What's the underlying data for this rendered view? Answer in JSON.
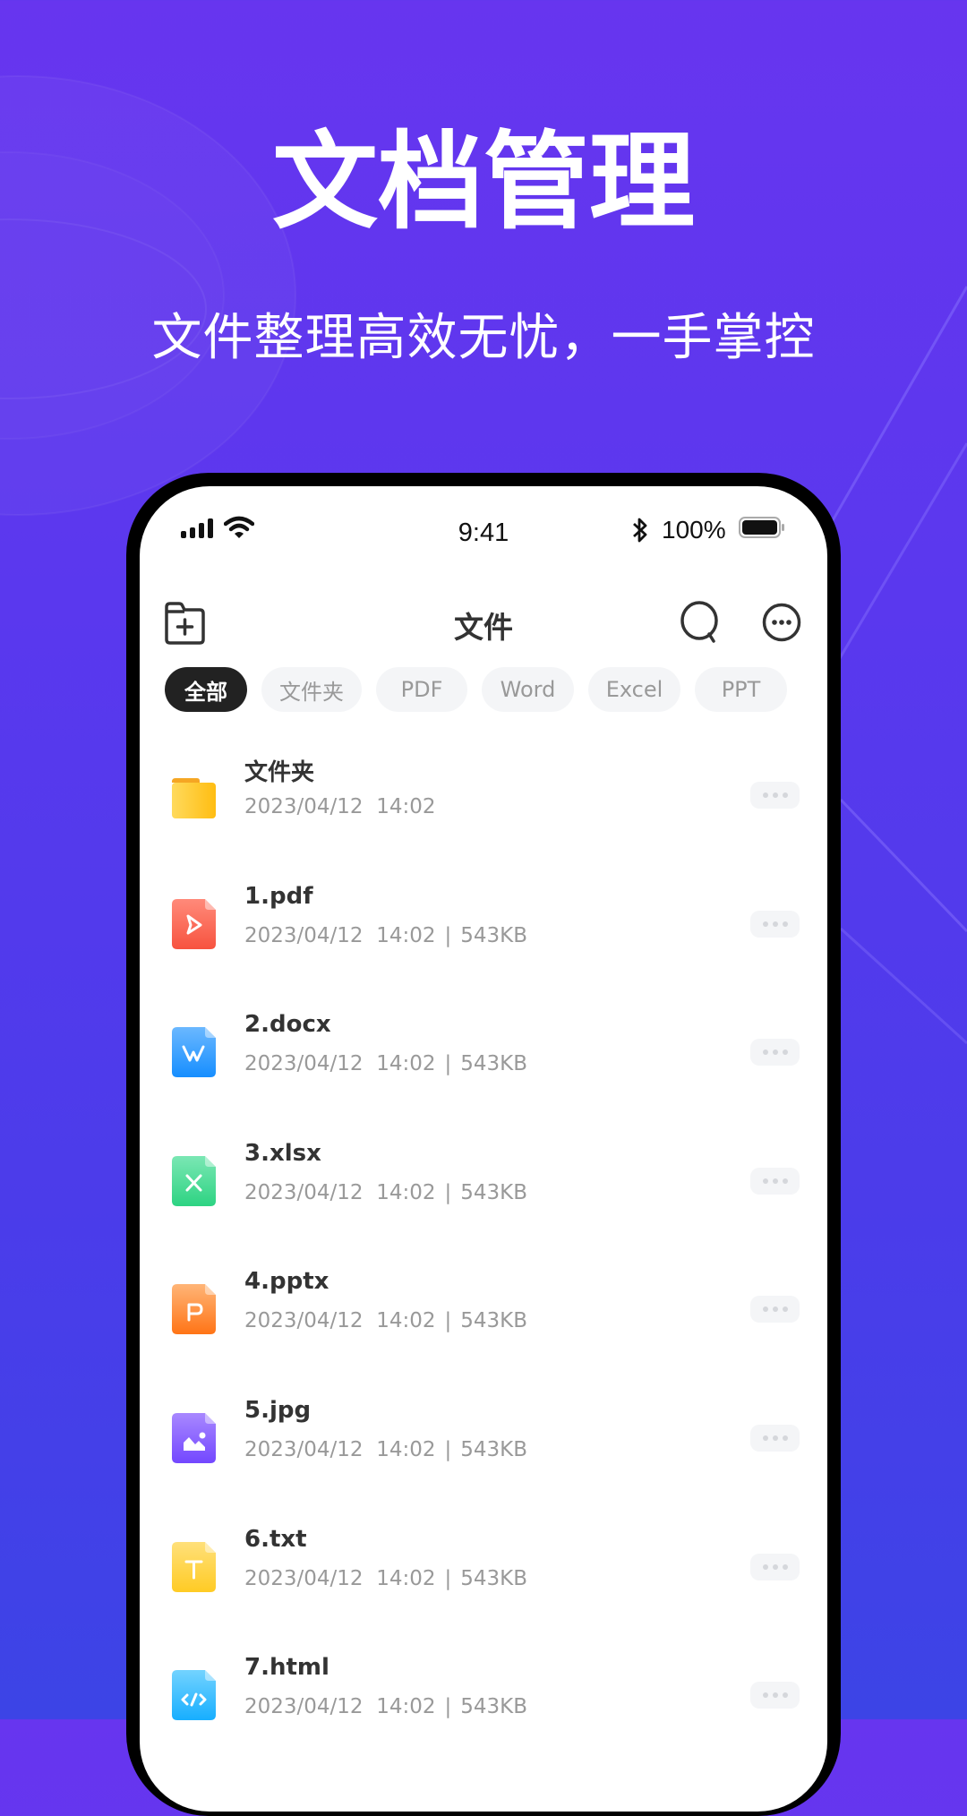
{
  "banner": {
    "headline": "文档管理",
    "subheadline": "文件整理高效无忧，一手掌控"
  },
  "status_bar": {
    "time": "9:41",
    "battery_percent": "100%",
    "icons": [
      "signal-icon",
      "wifi-icon",
      "bluetooth-icon",
      "battery-icon"
    ]
  },
  "header": {
    "title": "文件",
    "left_icon": "new-folder-icon",
    "right_icons": [
      "search-icon",
      "more-options-icon"
    ]
  },
  "filter_tabs": [
    {
      "label": "全部",
      "active": true
    },
    {
      "label": "文件夹",
      "active": false
    },
    {
      "label": "PDF",
      "active": false
    },
    {
      "label": "Word",
      "active": false
    },
    {
      "label": "Excel",
      "active": false
    },
    {
      "label": "PPT",
      "active": false
    }
  ],
  "files": [
    {
      "name": "文件夹",
      "date": "2023/04/12",
      "time": "14:02",
      "size": "",
      "type": "folder",
      "icon": "folder-icon",
      "color": "#FFC21A"
    },
    {
      "name": "1.pdf",
      "date": "2023/04/12",
      "time": "14:02",
      "size": "543KB",
      "type": "pdf",
      "icon": "pdf-file-icon",
      "color": "#FA5A4A"
    },
    {
      "name": "2.docx",
      "date": "2023/04/12",
      "time": "14:02",
      "size": "543KB",
      "type": "docx",
      "icon": "word-file-icon",
      "color": "#1E90FF"
    },
    {
      "name": "3.xlsx",
      "date": "2023/04/12",
      "time": "14:02",
      "size": "543KB",
      "type": "xlsx",
      "icon": "excel-file-icon",
      "color": "#2FD586"
    },
    {
      "name": "4.pptx",
      "date": "2023/04/12",
      "time": "14:02",
      "size": "543KB",
      "type": "pptx",
      "icon": "ppt-file-icon",
      "color": "#FF7A1A"
    },
    {
      "name": "5.jpg",
      "date": "2023/04/12",
      "time": "14:02",
      "size": "543KB",
      "type": "jpg",
      "icon": "image-file-icon",
      "color": "#7A4DFF"
    },
    {
      "name": "6.txt",
      "date": "2023/04/12",
      "time": "14:02",
      "size": "543KB",
      "type": "txt",
      "icon": "text-file-icon",
      "color": "#FFCE2E"
    },
    {
      "name": "7.html",
      "date": "2023/04/12",
      "time": "14:02",
      "size": "543KB",
      "type": "html",
      "icon": "html-file-icon",
      "color": "#1AB2FF"
    }
  ],
  "meta_separator": "|",
  "colors": {
    "bg_top": "#6735EF",
    "bg_bottom": "#3C44E6",
    "active_tab": "#222222",
    "inactive_tab": "#F4F5F7"
  }
}
